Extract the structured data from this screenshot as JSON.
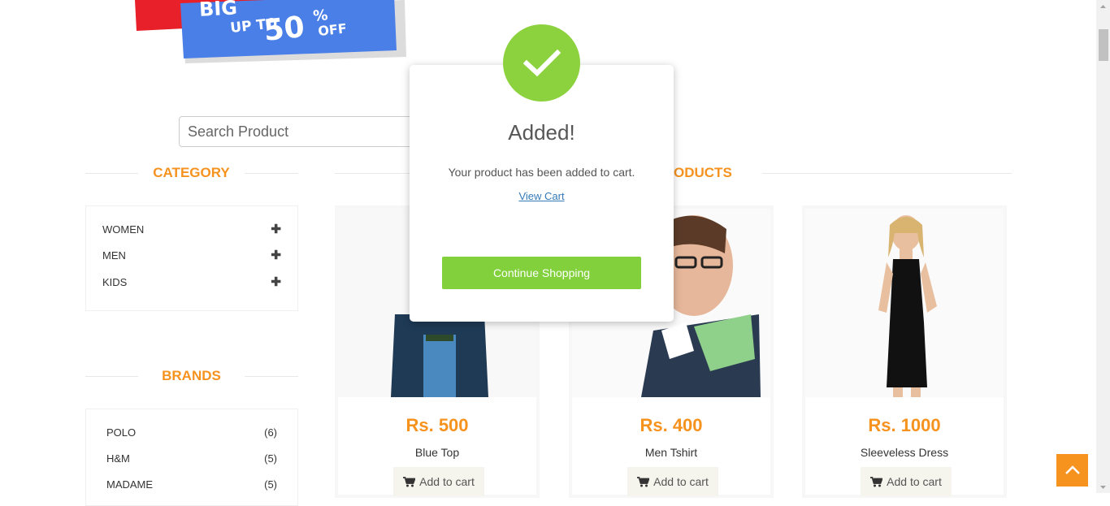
{
  "banner": {
    "up_to": "UP TO",
    "percent": "50",
    "percent_sign": "%",
    "off": "OFF"
  },
  "search": {
    "placeholder": "Search Product"
  },
  "category": {
    "heading": "CATEGORY",
    "items": [
      {
        "label": "WOMEN",
        "icon": "plus-icon"
      },
      {
        "label": "MEN",
        "icon": "plus-icon"
      },
      {
        "label": "KIDS",
        "icon": "plus-icon"
      }
    ]
  },
  "brands": {
    "heading": "BRANDS",
    "items": [
      {
        "label": "POLO",
        "count": "(6)"
      },
      {
        "label": "H&M",
        "count": "(5)"
      },
      {
        "label": "MADAME",
        "count": "(5)"
      }
    ]
  },
  "products": {
    "heading": "PRODUCTS",
    "visible_heading": "ODUCTS",
    "items": [
      {
        "price": "Rs. 500",
        "name": "Blue Top",
        "button": "Add to cart"
      },
      {
        "price": "Rs. 400",
        "name": "Men Tshirt",
        "button": "Add to cart"
      },
      {
        "price": "Rs. 1000",
        "name": "Sleeveless Dress",
        "button": "Add to cart"
      }
    ]
  },
  "modal": {
    "title": "Added!",
    "message": "Your product has been added to cart.",
    "link": "View Cart",
    "button": "Continue Shopping"
  },
  "colors": {
    "accent": "#f6921e",
    "success": "#8cd23f",
    "link": "#337ab7"
  }
}
